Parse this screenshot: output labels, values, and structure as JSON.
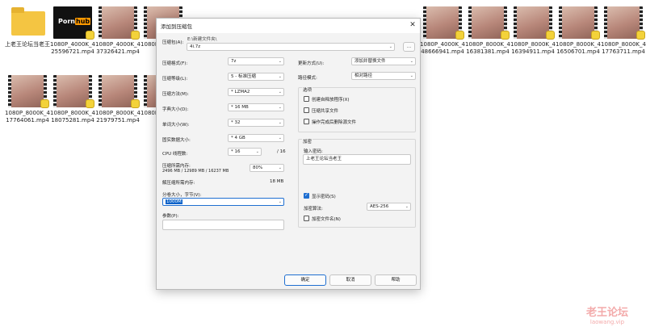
{
  "desktop": {
    "files": [
      {
        "label": "上老王论坛当老王",
        "kind": "folder"
      },
      {
        "label": "1080P_4000K_425596721.mp4",
        "kind": "pornhub"
      },
      {
        "label": "1080P_4000K_437326421.mp4",
        "kind": "video"
      },
      {
        "label": "1080P_4000K_440",
        "kind": "video"
      },
      {
        "label": "1080P_4000K_448666941.mp4",
        "kind": "video"
      },
      {
        "label": "1080P_8000K_416381381.mp4",
        "kind": "video"
      },
      {
        "label": "1080P_8000K_416394911.mp4",
        "kind": "video"
      },
      {
        "label": "1080P_8000K_416506701.mp4",
        "kind": "video"
      },
      {
        "label": "1080P_8000K_417763711.mp4",
        "kind": "video"
      },
      {
        "label": "1080P_8000K_417764061.mp4",
        "kind": "video"
      },
      {
        "label": "1080P_8000K_418075281.mp4",
        "kind": "video"
      },
      {
        "label": "1080P_8000K_421979751.mp4",
        "kind": "video"
      },
      {
        "label": "1080P_8000K_4222",
        "kind": "video"
      }
    ],
    "pornhub_logo": {
      "left": "Porn",
      "right": "hub"
    }
  },
  "dialog": {
    "title": "添加到压缩包",
    "close_label": "✕",
    "archive_label": "压缩包(A):",
    "archive_dir": "E:\\新建文件夹\\",
    "archive_name": "4i.7z",
    "browse_label": "...",
    "format_label": "压缩格式(F):",
    "format_value": "7z",
    "level_label": "压缩等级(L):",
    "level_value": "5 - 标准压缩",
    "method_label": "压缩方法(M):",
    "method_value": "* LZMA2",
    "dict_label": "字典大小(D):",
    "dict_value": "* 16 MB",
    "word_label": "单词大小(W):",
    "word_value": "* 32",
    "solid_label": "固实数据大小:",
    "solid_value": "* 4 GB",
    "threads_label": "CPU 线程数:",
    "threads_value": "* 16",
    "threads_max": "/ 16",
    "mem_label": "压缩所需内存:",
    "mem_detail": "2496 MB / 12989 MB / 16237 MB",
    "mem_percent": "80%",
    "decomp_label": "解压缩所需内存:",
    "decomp_value": "18 MB",
    "split_label": "分卷大小，字节(V):",
    "split_value": "1000M",
    "params_label": "参数(P):",
    "params_value": "",
    "update_label": "更新方式(U):",
    "update_value": "添加并替换文件",
    "path_label": "路径模式:",
    "path_value": "相对路径",
    "options_title": "选项",
    "opt_sfx": "创建自释放程序(X)",
    "opt_shared": "压缩共享文件",
    "opt_delete": "操作完成后删除源文件",
    "encrypt_title": "加密",
    "password_label": "输入密码:",
    "password_value": "上老王论坛当老王",
    "show_password": "显示密码(S)",
    "enc_method_label": "加密算法:",
    "enc_method_value": "AES-256",
    "encrypt_names": "加密文件名(N)",
    "ok_label": "确定",
    "cancel_label": "取消",
    "help_label": "帮助"
  },
  "watermark": {
    "line1": "老王论坛",
    "line2": "laowang.vip"
  }
}
